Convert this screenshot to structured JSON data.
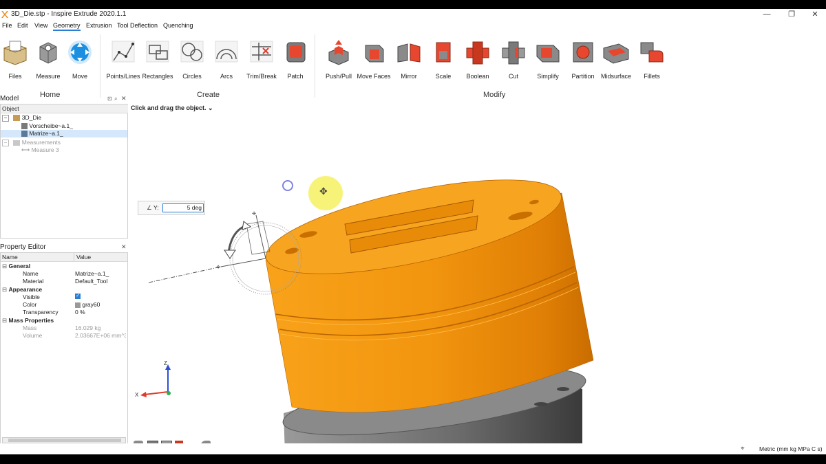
{
  "window": {
    "title": "3D_Die.stp - Inspire Extrude 2020.1.1"
  },
  "menu": [
    "File",
    "Edit",
    "View",
    "Geometry",
    "Extrusion",
    "Tool Deflection",
    "Quenching"
  ],
  "ribbon": {
    "home": {
      "label": "Home",
      "tools": [
        "Files",
        "Measure",
        "Move"
      ]
    },
    "create": {
      "label": "Create",
      "tools": [
        "Points/Lines",
        "Rectangles",
        "Circles",
        "Arcs",
        "Trim/Break",
        "Patch"
      ]
    },
    "modify": {
      "label": "Modify",
      "tools": [
        "Push/Pull",
        "Move Faces",
        "Mirror",
        "Scale",
        "Boolean",
        "Cut",
        "Simplify",
        "Partition",
        "Midsurface",
        "Fillets"
      ]
    }
  },
  "model_panel": {
    "title": "Model",
    "column": "Object",
    "tree": {
      "root": "3D_Die",
      "part1": "Vorscheibe~a.1_",
      "part2": "Matrize~a.1_",
      "measurements": "Measurements",
      "measure": "Measure 3"
    }
  },
  "property_editor": {
    "title": "Property Editor",
    "col_name": "Name",
    "col_value": "Value",
    "general": {
      "label": "General",
      "name_k": "Name",
      "name_v": "Matrize~a.1_",
      "material_k": "Material",
      "material_v": "Default_Tool"
    },
    "appearance": {
      "label": "Appearance",
      "visible_k": "Visible",
      "color_k": "Color",
      "color_v": "gray60",
      "transparency_k": "Transparency",
      "transparency_v": "0 %"
    },
    "mass": {
      "label": "Mass Properties",
      "mass_k": "Mass",
      "mass_v": "16.029 kg",
      "volume_k": "Volume",
      "volume_v": "2.03667E+06 mm^3"
    }
  },
  "viewport": {
    "hint": "Click and drag the object.",
    "angle_label": "Y:",
    "angle_value": "5 deg",
    "axis_z": "Z",
    "axis_x": "X"
  },
  "status": {
    "units": "Metric (mm kg MPa C s)"
  },
  "colors": {
    "accent": "#2a7fd4",
    "part_orange": "#f5a01a",
    "part_gray": "#7a7a7a"
  }
}
